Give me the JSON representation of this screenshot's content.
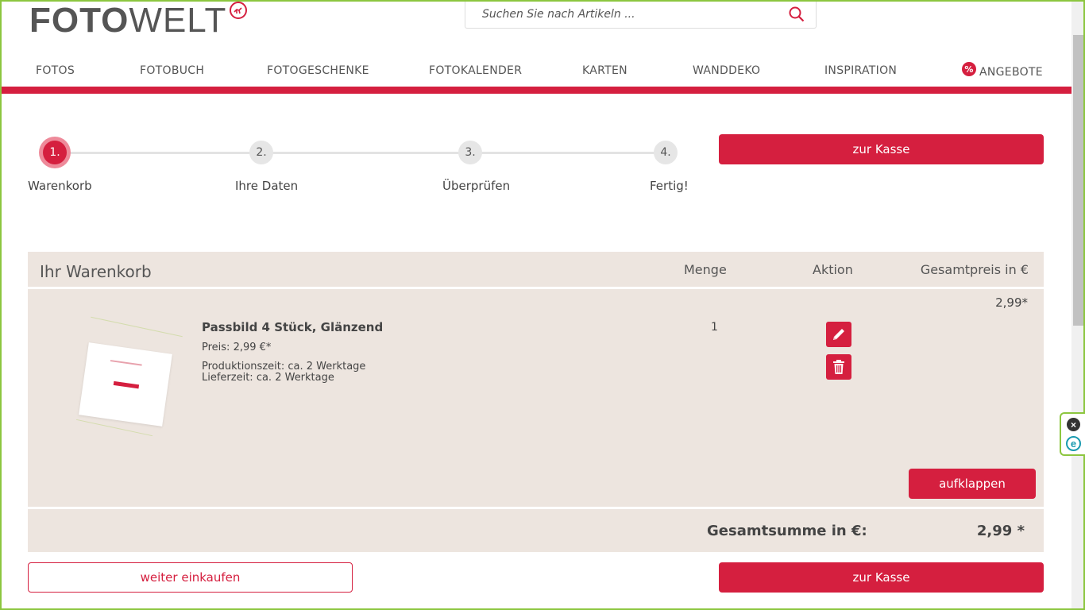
{
  "header": {
    "logo_bold": "FOTO",
    "logo_light": "WELT",
    "search_placeholder": "Suchen Sie nach Artikeln ..."
  },
  "nav": {
    "items": [
      "FOTOS",
      "FOTOBUCH",
      "FOTOGESCHENKE",
      "FOTOKALENDER",
      "KARTEN",
      "WANDDEKO",
      "INSPIRATION"
    ],
    "offer_label": "ANGEBOTE",
    "offer_icon_text": "%"
  },
  "steps": [
    {
      "number": "1.",
      "label": "Warenkorb",
      "active": true
    },
    {
      "number": "2.",
      "label": "Ihre Daten",
      "active": false
    },
    {
      "number": "3.",
      "label": "Überprüfen",
      "active": false
    },
    {
      "number": "4.",
      "label": "Fertig!",
      "active": false
    }
  ],
  "buttons": {
    "checkout_top": "zur Kasse",
    "checkout_bottom": "zur Kasse",
    "continue_shopping": "weiter einkaufen",
    "expand": "aufklappen"
  },
  "cart": {
    "title": "Ihr Warenkorb",
    "columns": {
      "quantity": "Menge",
      "action": "Aktion",
      "total": "Gesamtpreis in €"
    },
    "items": [
      {
        "name": "Passbild 4 Stück, Glänzend",
        "price": "Preis: 2,99 €*",
        "production_time": "Produktionszeit: ca. 2 Werktage",
        "delivery_time": "Lieferzeit: ca. 2 Werktage",
        "quantity": "1",
        "total": "2,99*",
        "edit_icon": "pencil-icon",
        "delete_icon": "trash-icon"
      }
    ],
    "sum_label": "Gesamtsumme in €:",
    "sum_value": "2,99 *"
  },
  "side_widget": {
    "close_symbol": "×",
    "badge_letter": "e"
  },
  "colors": {
    "accent": "#d51f3f",
    "cart_bg": "#ede5df",
    "frame": "#8cc63f"
  }
}
